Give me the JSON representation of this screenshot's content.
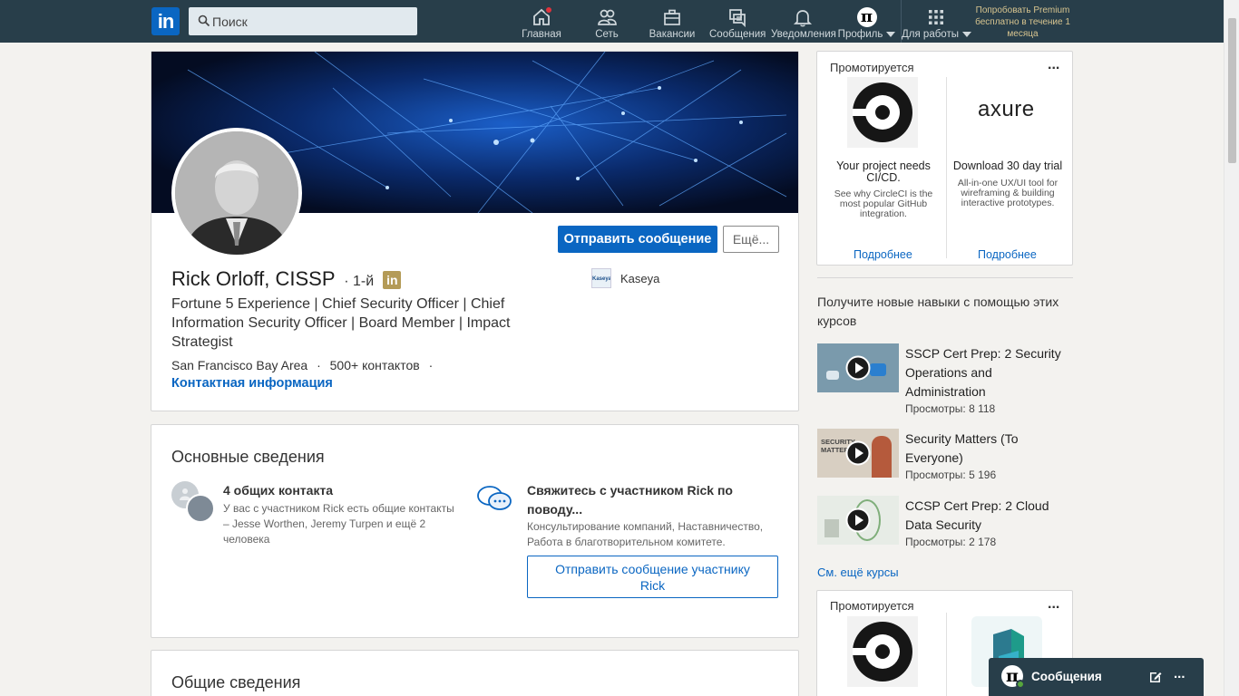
{
  "nav": {
    "logo_text": "in",
    "search_placeholder": "Поиск",
    "items": [
      {
        "label": "Главная"
      },
      {
        "label": "Сеть"
      },
      {
        "label": "Вакансии"
      },
      {
        "label": "Сообщения"
      },
      {
        "label": "Уведомления"
      },
      {
        "label": "Профиль"
      },
      {
        "label": "Для работы"
      }
    ],
    "premium": "Попробовать Premium бесплатно в течение 1 месяца",
    "profile_glyph": "π"
  },
  "profile": {
    "name": "Rick Orloff, CISSP",
    "degree": "· 1-й",
    "headline": "Fortune 5 Experience | Chief Security Officer | Chief Information Security Officer | Board Member | Impact Strategist",
    "location": "San Francisco Bay Area",
    "connections": "500+ контактов",
    "dot": "·",
    "contact_info": "Контактная информация",
    "send_message": "Отправить сообщение",
    "more": "Ещё...",
    "company": "Kaseya",
    "company_logo_text": "Kaseya"
  },
  "highlights": {
    "title": "Основные сведения",
    "mutual_title": "4 общих контакта",
    "mutual_desc": "У вас с участником Rick есть общие контакты – Jesse Worthen, Jeremy Turpen и ещё 2 человека",
    "reach_title": "Свяжитесь с участником Rick по поводу...",
    "reach_desc": "Консультирование компаний, Наставничество, Работа в благотворительном комитете.",
    "reach_button": "Отправить сообщение участнику Rick"
  },
  "about": {
    "title": "Общие сведения"
  },
  "ads": {
    "promoted": "Промотируется",
    "more": "...",
    "items": [
      {
        "title": "Your project needs CI/CD.",
        "desc": "See why CircleCI is the most popular GitHub integration.",
        "cta": "Подробнее"
      },
      {
        "title": "Download 30 day trial",
        "desc": "All-in-one UX/UI tool for wireframing & building interactive prototypes.",
        "cta": "Подробнее",
        "logo": "axure"
      }
    ]
  },
  "courses": {
    "heading": "Получите новые навыки с помощью этих курсов",
    "items": [
      {
        "title": "SSCP Cert Prep: 2 Security Operations and Administration",
        "views": "Просмотры: 8 118"
      },
      {
        "title": "Security Matters (To Everyone)",
        "views": "Просмотры: 5 196",
        "thumb_text": "SECURITY MATTERS"
      },
      {
        "title": "CCSP Cert Prep: 2 Cloud Data Security",
        "views": "Просмотры: 2 178"
      }
    ],
    "see_more": "См. ещё курсы"
  },
  "ads2": {
    "promoted": "Промотируется",
    "more": "..."
  },
  "messaging": {
    "label": "Сообщения",
    "more": "...",
    "glyph": "π"
  },
  "colors": {
    "nav_bg": "#283e4a",
    "accent": "#0a66c2",
    "premium_gold": "#d7c48f"
  }
}
